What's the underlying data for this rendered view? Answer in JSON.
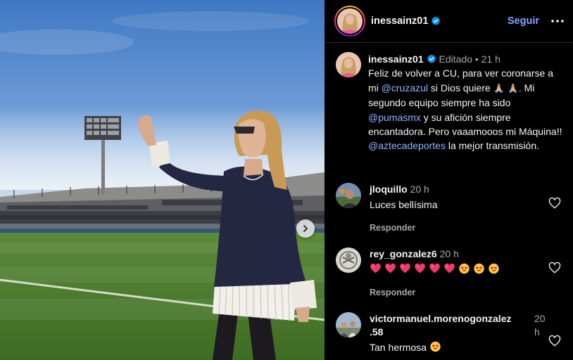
{
  "post": {
    "username": "inessainz01",
    "follow_label": "Seguir",
    "carousel_next": "Siguiente"
  },
  "caption": {
    "username": "inessainz01",
    "edited_label": "Editado",
    "separator": "•",
    "time": "21 h",
    "text_1": "Feliz de volver a CU, para ver coronarse a mi ",
    "mention_1": "@cruzazul",
    "text_2": " si Dios quiere ",
    "emoji_1": "🙏🏼",
    "emoji_2": "🙏🏼",
    "text_3": ". Mi segundo equipo siempre ha sido ",
    "mention_2": "@pumasmx",
    "text_4": " y su afición siempre encantadora.  Pero vaaamooos mi Máquina!! ",
    "mention_3": "@aztecadeportes",
    "text_5": " la mejor transmisión."
  },
  "comments": [
    {
      "username": "jloquillo",
      "time": "20 h",
      "text": "Luces bellísima",
      "reply_label": "Responder"
    },
    {
      "username": "rey_gonzalez6",
      "time": "20 h",
      "emojis": [
        "heart",
        "heart",
        "heart",
        "heart",
        "heart",
        "heart",
        "heart-eyes",
        "heart-eyes",
        "heart-eyes"
      ],
      "reply_label": "Responder"
    },
    {
      "username": "victormanuel.morenogonzalez",
      "username_2": ".58",
      "time": "20",
      "time_2": "h",
      "text": "Tan hermosa"
    }
  ],
  "colors": {
    "link": "#85a2ff",
    "verified": "#0095f6",
    "heart_emoji": "#f2386b",
    "background": "#000000"
  },
  "icons": [
    "verified-badge-icon",
    "more-options-icon",
    "like-heart-icon",
    "chevron-right-icon"
  ]
}
